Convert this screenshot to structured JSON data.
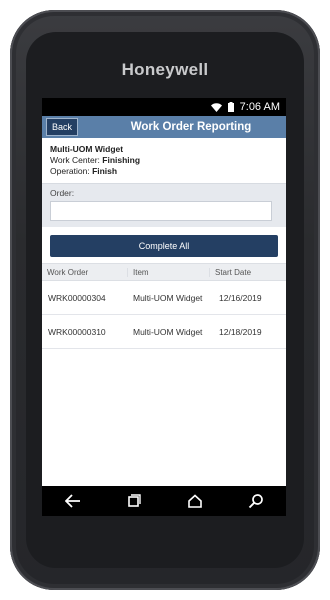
{
  "device": {
    "brand": "Honeywell"
  },
  "status": {
    "time": "7:06 AM",
    "icons": [
      "wifi-icon",
      "battery-icon"
    ]
  },
  "appbar": {
    "back_label": "Back",
    "title": "Work Order Reporting"
  },
  "info": {
    "item_name": "Multi-UOM Widget",
    "work_center_label": "Work Center: ",
    "work_center_value": "Finishing",
    "operation_label": "Operation: ",
    "operation_value": "Finish"
  },
  "order": {
    "label": "Order:",
    "value": "",
    "placeholder": ""
  },
  "actions": {
    "complete_all_label": "Complete All"
  },
  "table": {
    "headers": [
      "Work Order",
      "Item",
      "Start Date"
    ],
    "rows": [
      {
        "work_order": "WRK00000304",
        "item": "Multi-UOM Widget",
        "start_date": "12/16/2019"
      },
      {
        "work_order": "WRK00000310",
        "item": "Multi-UOM Widget",
        "start_date": "12/18/2019"
      }
    ]
  },
  "navbar": {
    "icons": [
      "back-nav-icon",
      "recents-icon",
      "home-icon",
      "search-icon"
    ]
  },
  "colors": {
    "appbar": "#5a7fa8",
    "button": "#243f63",
    "panel": "#e6e9ee"
  }
}
